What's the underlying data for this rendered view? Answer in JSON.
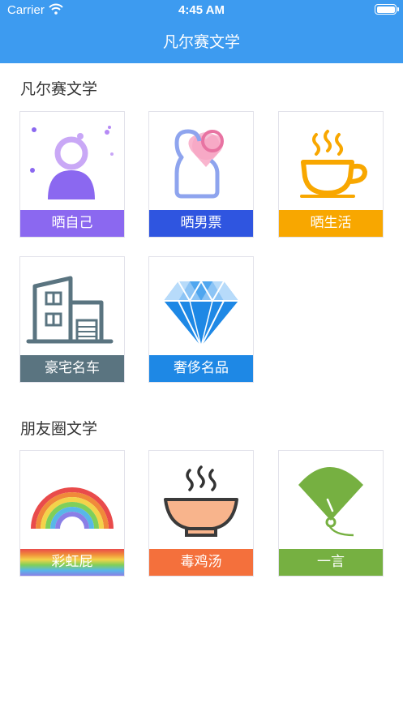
{
  "status_bar": {
    "carrier": "Carrier",
    "time": "4:45 AM"
  },
  "nav": {
    "title": "凡尔赛文学"
  },
  "sections": [
    {
      "title": "凡尔赛文学",
      "tiles": [
        {
          "label": "晒自己",
          "icon": "person-icon",
          "color": "#8b68f0"
        },
        {
          "label": "晒男票",
          "icon": "couple-icon",
          "color": "#2f55e0"
        },
        {
          "label": "晒生活",
          "icon": "coffee-cup-icon",
          "color": "#f8a700"
        },
        {
          "label": "豪宅名车",
          "icon": "building-icon",
          "color": "#5a7480"
        },
        {
          "label": "奢侈名品",
          "icon": "diamond-icon",
          "color": "#1e88e5"
        }
      ]
    },
    {
      "title": "朋友圈文学",
      "tiles": [
        {
          "label": "彩虹屁",
          "icon": "rainbow-icon",
          "color": "rainbow"
        },
        {
          "label": "毒鸡汤",
          "icon": "soup-bowl-icon",
          "color": "#f4703c"
        },
        {
          "label": "一言",
          "icon": "fan-icon",
          "color": "#76b041"
        }
      ]
    }
  ]
}
